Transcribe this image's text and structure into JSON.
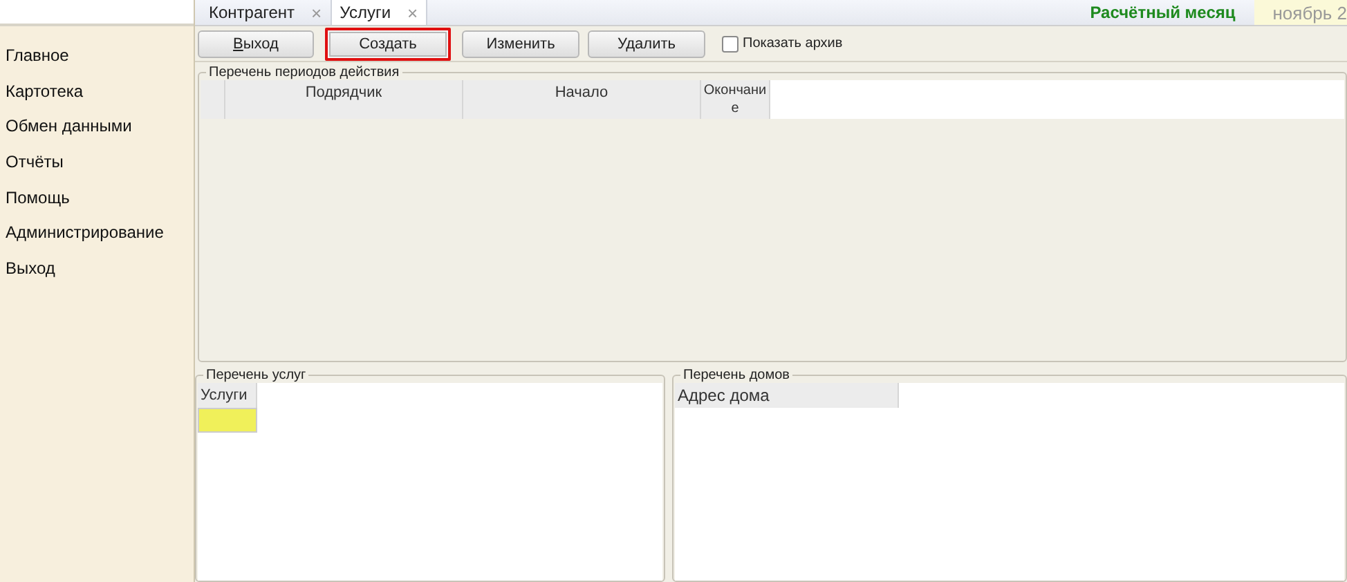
{
  "tabs": [
    {
      "label": "Контрагент",
      "close": "×",
      "selected": false
    },
    {
      "label": "Услуги",
      "close": "×",
      "selected": true
    }
  ],
  "period": {
    "label": "Расчётный месяц",
    "value": "ноябрь 2"
  },
  "sidebar": {
    "items": [
      "Главное",
      "Картотека",
      "Обмен данными",
      "Отчёты",
      "Помощь",
      "Администрирование",
      "Выход"
    ]
  },
  "toolbar": {
    "buttons": [
      {
        "label": "Выход",
        "highlighted": false
      },
      {
        "label": "Создать",
        "highlighted": true
      },
      {
        "label": "Изменить",
        "highlighted": false
      },
      {
        "label": "Удалить",
        "highlighted": false
      }
    ],
    "archive": {
      "label": "Показать архив",
      "checked": false
    }
  },
  "periods": {
    "title": "Перечень периодов действия",
    "columns": [
      "Подрядчик",
      "Начало",
      "Окончание"
    ]
  },
  "services": {
    "title": "Перечень услуг",
    "columns": [
      "Услуги"
    ],
    "rows": [
      {
        "selected": true
      }
    ]
  },
  "houses": {
    "title": "Перечень домов",
    "columns": [
      "Адрес дома"
    ]
  }
}
